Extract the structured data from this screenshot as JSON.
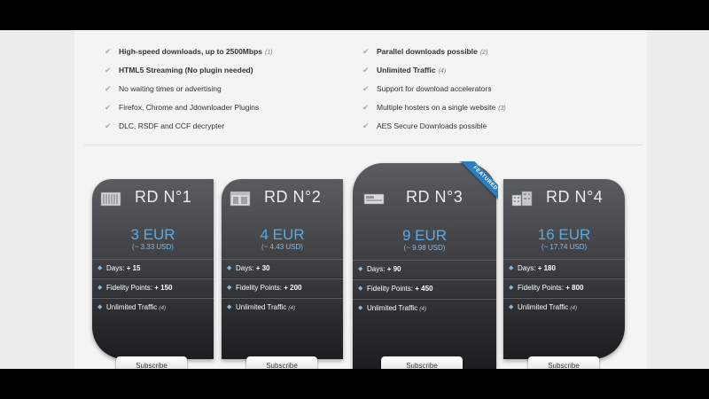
{
  "features": {
    "left": [
      {
        "text": "High-speed downloads, up to 2500Mbps",
        "note": "(1)",
        "bold": true
      },
      {
        "text": "HTML5 Streaming (No plugin needed)",
        "note": "",
        "bold": true
      },
      {
        "text": "No waiting times or advertising",
        "note": "",
        "bold": false
      },
      {
        "text": "Firefox, Chrome and Jdownloader Plugins",
        "note": "",
        "bold": false
      },
      {
        "text": "DLC, RSDF and CCF decrypter",
        "note": "",
        "bold": false
      }
    ],
    "right": [
      {
        "text": "Parallel downloads possible",
        "note": "(2)",
        "bold": true
      },
      {
        "text": "Unlimited Traffic",
        "note": "(4)",
        "bold": true
      },
      {
        "text": "Support for download accelerators",
        "note": "",
        "bold": false
      },
      {
        "text": "Multiple hosters on a single website",
        "note": "(3)",
        "bold": false
      },
      {
        "text": "AES Secure Downloads possible",
        "note": "",
        "bold": false
      }
    ]
  },
  "plans": [
    {
      "title": "RD N°1",
      "price": "3 EUR",
      "usd": "(~ 3.33 USD)",
      "days_label": "Days:",
      "days": "+ 15",
      "fidelity_label": "Fidelity Points:",
      "fidelity": "+ 150",
      "traffic": "Unlimited Traffic",
      "traffic_note": "(4)",
      "button": "Subscribe"
    },
    {
      "title": "RD N°2",
      "price": "4 EUR",
      "usd": "(~ 4.43 USD)",
      "days_label": "Days:",
      "days": "+ 30",
      "fidelity_label": "Fidelity Points:",
      "fidelity": "+ 200",
      "traffic": "Unlimited Traffic",
      "traffic_note": "(4)",
      "button": "Subscribe"
    },
    {
      "title": "RD N°3",
      "price": "9 EUR",
      "usd": "(~ 9.98 USD)",
      "days_label": "Days:",
      "days": "+ 90",
      "fidelity_label": "Fidelity Points:",
      "fidelity": "+ 450",
      "traffic": "Unlimited Traffic",
      "traffic_note": "(4)",
      "button": "Subscribe",
      "ribbon": "FEATURED"
    },
    {
      "title": "RD N°4",
      "price": "16 EUR",
      "usd": "(~ 17.74 USD)",
      "days_label": "Days:",
      "days": "+ 180",
      "fidelity_label": "Fidelity Points:",
      "fidelity": "+ 800",
      "traffic": "Unlimited Traffic",
      "traffic_note": "(4)",
      "button": "Subscribe"
    }
  ],
  "colors": {
    "accent": "#5aa9e3",
    "ribbon": "#2a7fc4",
    "card_top": "#5a5c5f",
    "card_bottom": "#1c1d1f"
  }
}
